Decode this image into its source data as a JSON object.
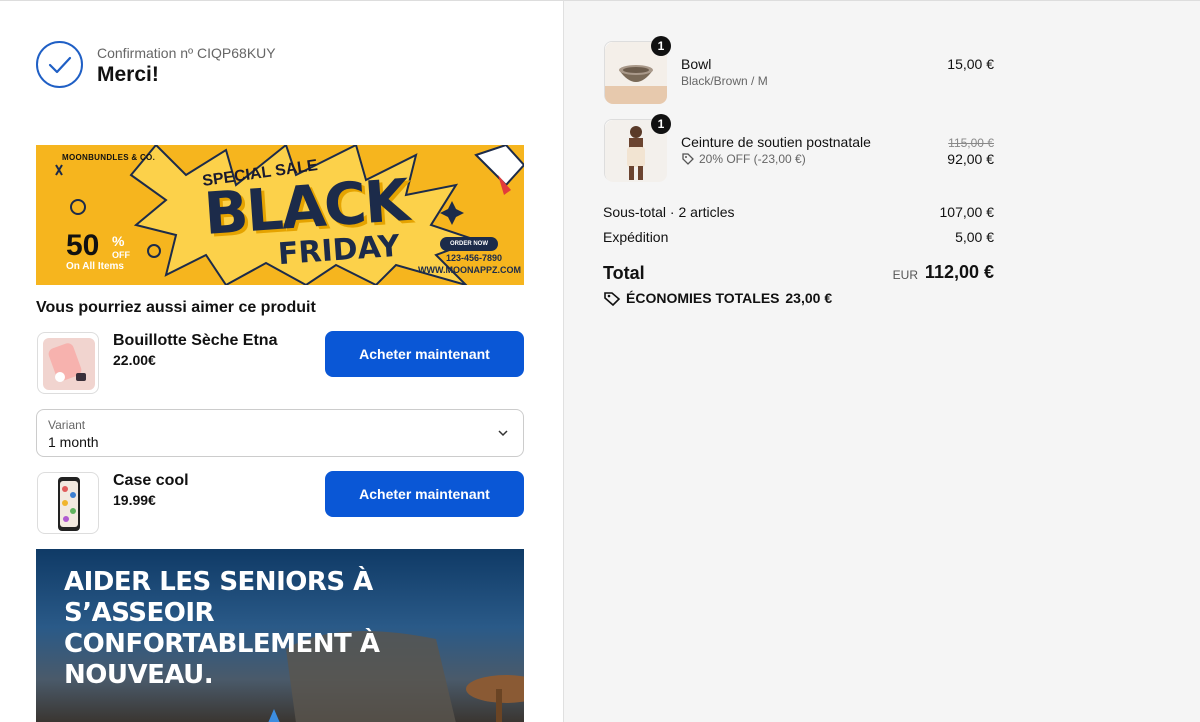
{
  "confirmation": {
    "number_label": "Confirmation nº CIQP68KUY",
    "title": "Merci!"
  },
  "black_friday_banner": {
    "brand": "MOONBUNDLES & CO.",
    "special": "SPECIAL SALE",
    "black": "BLACK",
    "friday": "FRIDAY",
    "discount": "50",
    "pct": "%",
    "off": "OFF",
    "all_items": "On All Items",
    "order_now": "ORDER NOW",
    "phone": "123-456-7890",
    "website": "WWW.MOONAPPZ.COM"
  },
  "upsell": {
    "title": "Vous pourriez aussi aimer ce produit",
    "products": [
      {
        "name": "Bouillotte Sèche Etna",
        "price": "22.00€",
        "button": "Acheter maintenant"
      },
      {
        "name": "Case cool",
        "price": "19.99€",
        "button": "Acheter maintenant"
      }
    ],
    "variant": {
      "label": "Variant",
      "value": "1 month"
    }
  },
  "seniors_banner": {
    "line1": "AIDER LES SENIORS À S’ASSEOIR",
    "line2": "CONFORTABLEMENT À NOUVEAU."
  },
  "order": {
    "items": [
      {
        "name": "Bowl",
        "variant": "Black/Brown / M",
        "quantity": "1",
        "price": "15,00 €"
      },
      {
        "name": "Ceinture de soutien postnatale",
        "discount": "20% OFF (-23,00 €)",
        "quantity": "1",
        "old_price": "115,00 €",
        "price": "92,00 €"
      }
    ],
    "subtotal_label": "Sous-total · 2 articles",
    "subtotal": "107,00 €",
    "shipping_label": "Expédition",
    "shipping": "5,00 €",
    "total_label": "Total",
    "currency": "EUR",
    "total": "112,00 €",
    "savings_label": "ÉCONOMIES TOTALES",
    "savings": "23,00 €"
  },
  "colors": {
    "accent": "#0a57d6",
    "check": "#1f5fc5",
    "banner_yellow": "#f6b51e",
    "summary_bg": "#f5f5f5"
  }
}
